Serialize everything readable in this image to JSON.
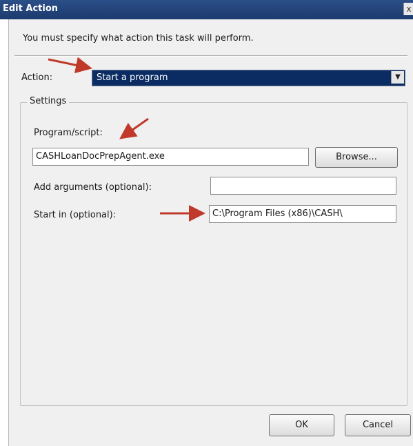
{
  "window": {
    "title": "Edit Action",
    "close_glyph": "x"
  },
  "instruction": "You must specify what action this task will perform.",
  "action": {
    "label": "Action:",
    "selected": "Start a program",
    "dropdown_glyph": "▼"
  },
  "settings": {
    "legend": "Settings",
    "program_label": "Program/script:",
    "program_value": "CASHLoanDocPrepAgent.exe",
    "browse_label": "Browse...",
    "arguments_label": "Add arguments (optional):",
    "arguments_value": "",
    "start_in_label": "Start in (optional):",
    "start_in_value": "C:\\Program Files (x86)\\CASH\\"
  },
  "footer": {
    "ok_label": "OK",
    "cancel_label": "Cancel"
  },
  "colors": {
    "arrow": "#c0392b",
    "selection": "#0a2c62",
    "titlebar": "#1f3f78"
  }
}
